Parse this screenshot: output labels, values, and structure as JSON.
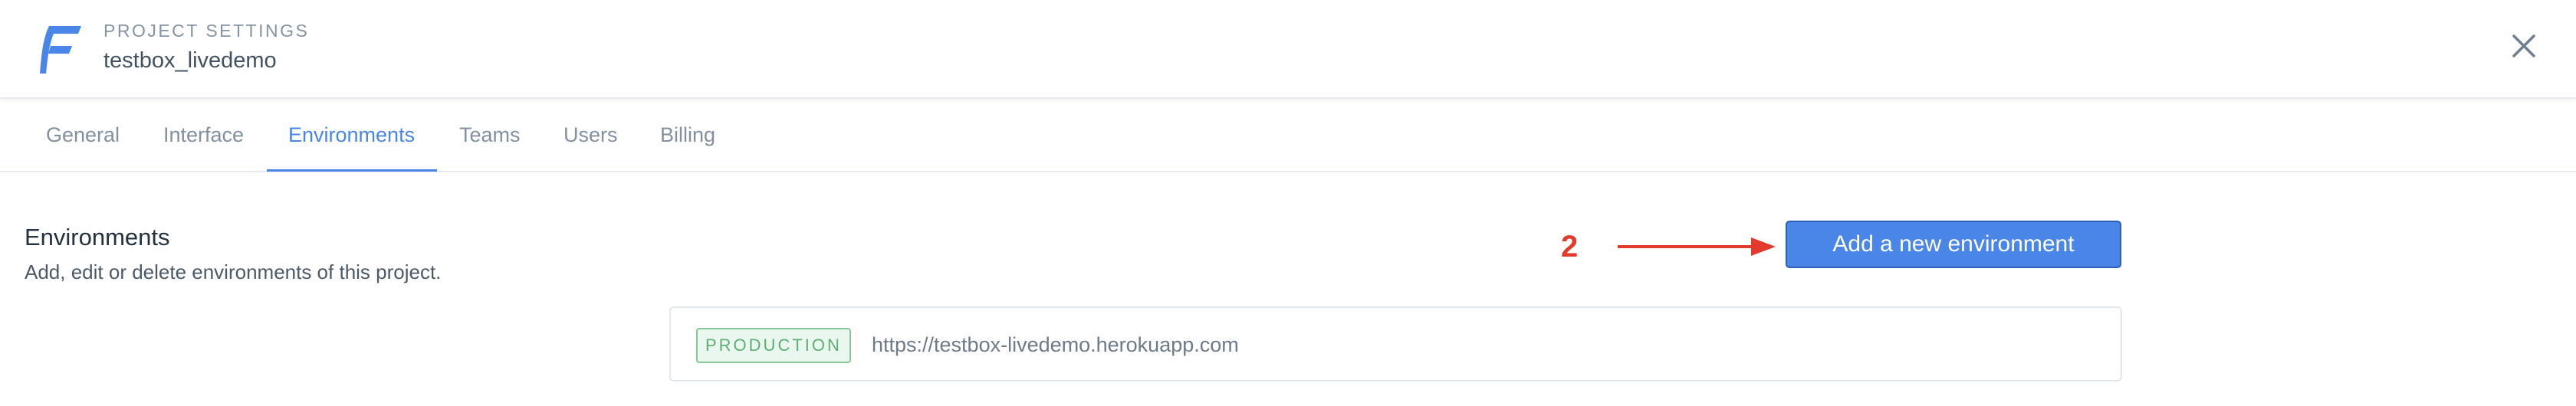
{
  "header": {
    "kicker": "PROJECT SETTINGS",
    "title": "testbox_livedemo",
    "logo_icon": "forest-admin-logo",
    "close_icon": "close-icon"
  },
  "tabs": [
    {
      "label": "General",
      "active": false
    },
    {
      "label": "Interface",
      "active": false
    },
    {
      "label": "Environments",
      "active": true
    },
    {
      "label": "Teams",
      "active": false
    },
    {
      "label": "Users",
      "active": false
    },
    {
      "label": "Billing",
      "active": false
    }
  ],
  "section": {
    "title": "Environments",
    "description": "Add, edit or delete environments of this project."
  },
  "annotation": {
    "number": "2",
    "color": "#e23a2d"
  },
  "add_button": {
    "label": "Add a new environment"
  },
  "environments": [
    {
      "badge": "PRODUCTION",
      "url": "https://testbox-livedemo.herokuapp.com"
    }
  ],
  "colors": {
    "accent": "#4a86e8",
    "badge_green": "#5fae73",
    "annotation_red": "#e23a2d"
  }
}
